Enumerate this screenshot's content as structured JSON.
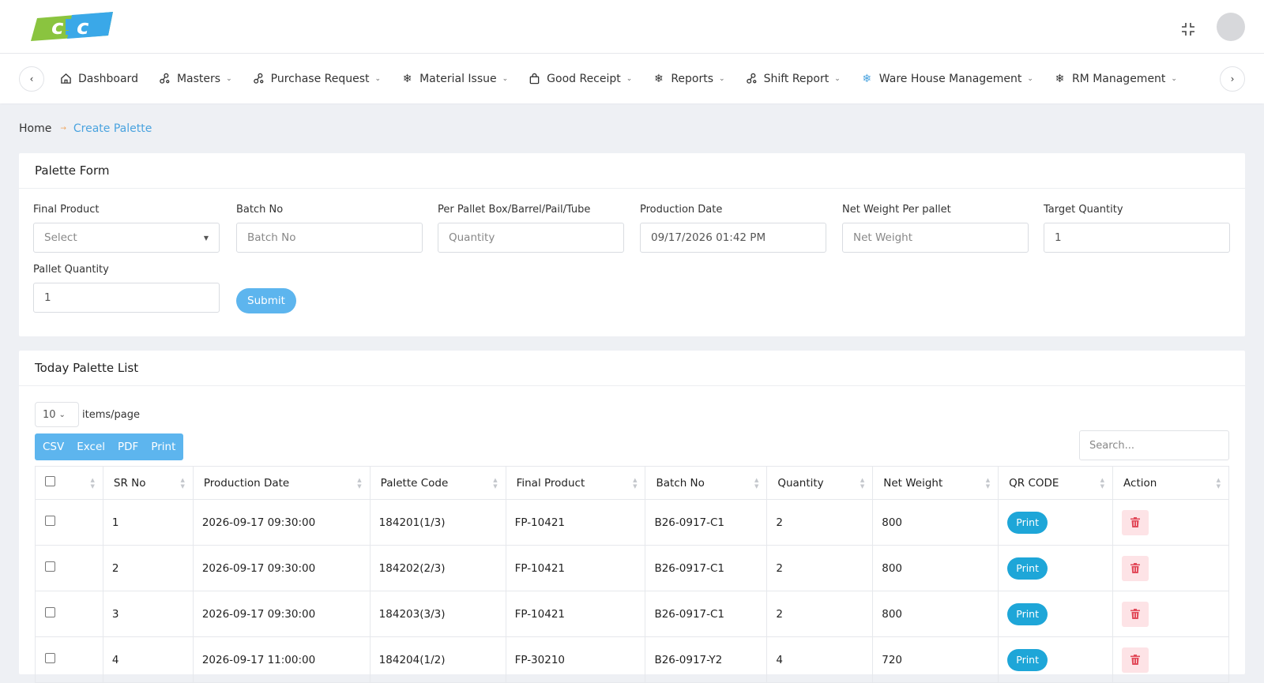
{
  "header": {
    "logo_text": "cic",
    "brand_colors": {
      "green": "#8ac43f",
      "blue": "#3aa8e8"
    }
  },
  "nav": {
    "items": [
      {
        "label": "Dashboard",
        "icon": "home-icon",
        "has_dropdown": false
      },
      {
        "label": "Masters",
        "icon": "link-nodes-icon",
        "has_dropdown": true
      },
      {
        "label": "Purchase Request",
        "icon": "link-nodes-icon",
        "has_dropdown": true
      },
      {
        "label": "Material Issue",
        "icon": "gear-icon",
        "has_dropdown": true
      },
      {
        "label": "Good Receipt",
        "icon": "bag-icon",
        "has_dropdown": true
      },
      {
        "label": "Reports",
        "icon": "gear-icon",
        "has_dropdown": true
      },
      {
        "label": "Shift Report",
        "icon": "link-nodes-icon",
        "has_dropdown": true
      },
      {
        "label": "Ware House Management",
        "icon": "gear-icon",
        "has_dropdown": true
      },
      {
        "label": "RM Management",
        "icon": "gear-icon",
        "has_dropdown": true
      }
    ]
  },
  "breadcrumb": {
    "home": "Home",
    "current": "Create Palette"
  },
  "form": {
    "title": "Palette Form",
    "final_product": {
      "label": "Final Product",
      "value": "Select"
    },
    "batch_no": {
      "label": "Batch No",
      "placeholder": "Batch No"
    },
    "per_pallet": {
      "label": "Per Pallet Box/Barrel/Pail/Tube",
      "placeholder": "Quantity"
    },
    "production_date": {
      "label": "Production Date",
      "value": "09/17/2026 01:42 PM"
    },
    "net_weight": {
      "label": "Net Weight Per pallet",
      "placeholder": "Net Weight"
    },
    "target_quantity": {
      "label": "Target Quantity",
      "value": "1"
    },
    "pallet_quantity": {
      "label": "Pallet Quantity",
      "value": "1"
    },
    "submit_label": "Submit"
  },
  "list": {
    "title": "Today Palette List",
    "per_page": "10",
    "per_page_label": "items/page",
    "export": [
      "CSV",
      "Excel",
      "PDF",
      "Print"
    ],
    "search_placeholder": "Search...",
    "columns": [
      "SR No",
      "Production Date",
      "Palette Code",
      "Final Product",
      "Batch No",
      "Quantity",
      "Net Weight",
      "QR CODE",
      "Action"
    ],
    "print_label": "Print",
    "rows": [
      {
        "sr": "1",
        "date": "2026-09-17 09:30:00",
        "code": "184201(1/3)",
        "product": "FP-10421",
        "batch": "B26-0917-C1",
        "qty": "2",
        "weight": "800"
      },
      {
        "sr": "2",
        "date": "2026-09-17 09:30:00",
        "code": "184202(2/3)",
        "product": "FP-10421",
        "batch": "B26-0917-C1",
        "qty": "2",
        "weight": "800"
      },
      {
        "sr": "3",
        "date": "2026-09-17 09:30:00",
        "code": "184203(3/3)",
        "product": "FP-10421",
        "batch": "B26-0917-C1",
        "qty": "2",
        "weight": "800"
      },
      {
        "sr": "4",
        "date": "2026-09-17 11:00:00",
        "code": "184204(1/2)",
        "product": "FP-30210",
        "batch": "B26-0917-Y2",
        "qty": "4",
        "weight": "720"
      }
    ]
  }
}
